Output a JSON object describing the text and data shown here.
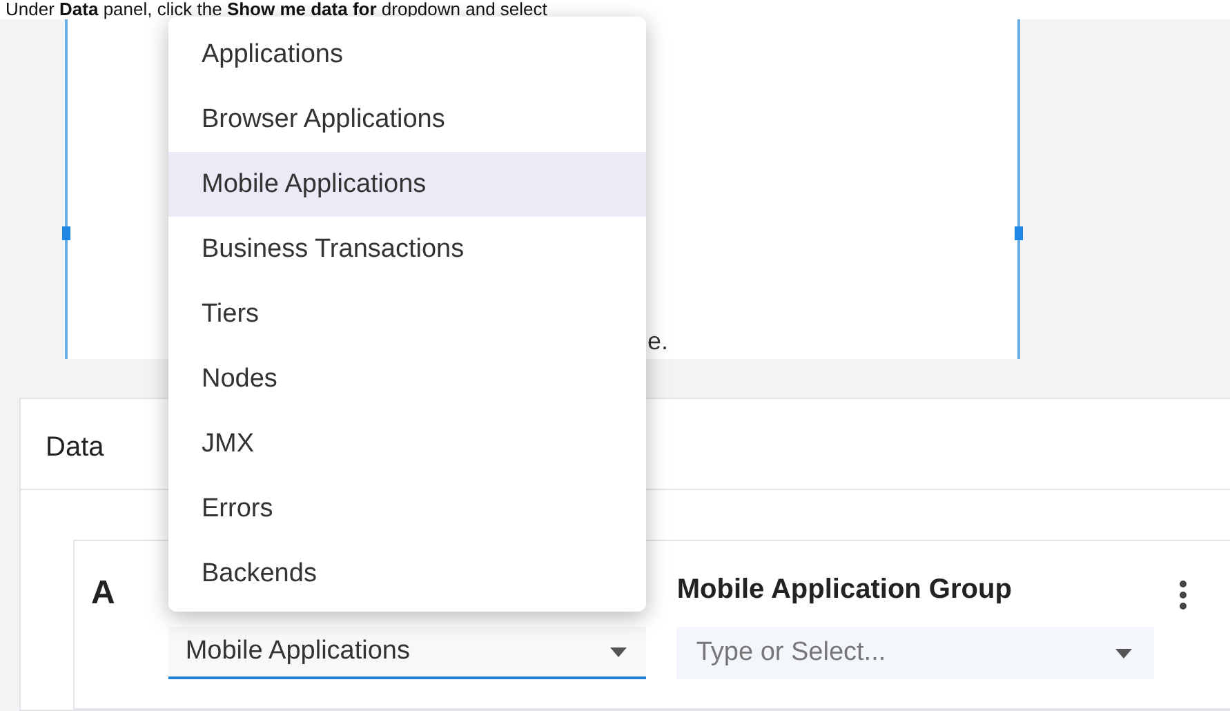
{
  "instruction": "Under **Data** panel, click the **Show me data for** dropdown and select",
  "canvas": {
    "partial_text": "e."
  },
  "data_panel": {
    "title": "Data",
    "query": {
      "letter": "A",
      "show_me_data_for": {
        "value": "Mobile Applications",
        "menu": [
          {
            "label": "Applications",
            "selected": false
          },
          {
            "label": "Browser Applications",
            "selected": false
          },
          {
            "label": "Mobile Applications",
            "selected": true
          },
          {
            "label": "Business Transactions",
            "selected": false
          },
          {
            "label": "Tiers",
            "selected": false
          },
          {
            "label": "Nodes",
            "selected": false
          },
          {
            "label": "JMX",
            "selected": false
          },
          {
            "label": "Errors",
            "selected": false
          },
          {
            "label": "Backends",
            "selected": false
          }
        ]
      },
      "group_field": {
        "label": "Mobile Application Group",
        "placeholder": "Type or Select..."
      }
    }
  }
}
